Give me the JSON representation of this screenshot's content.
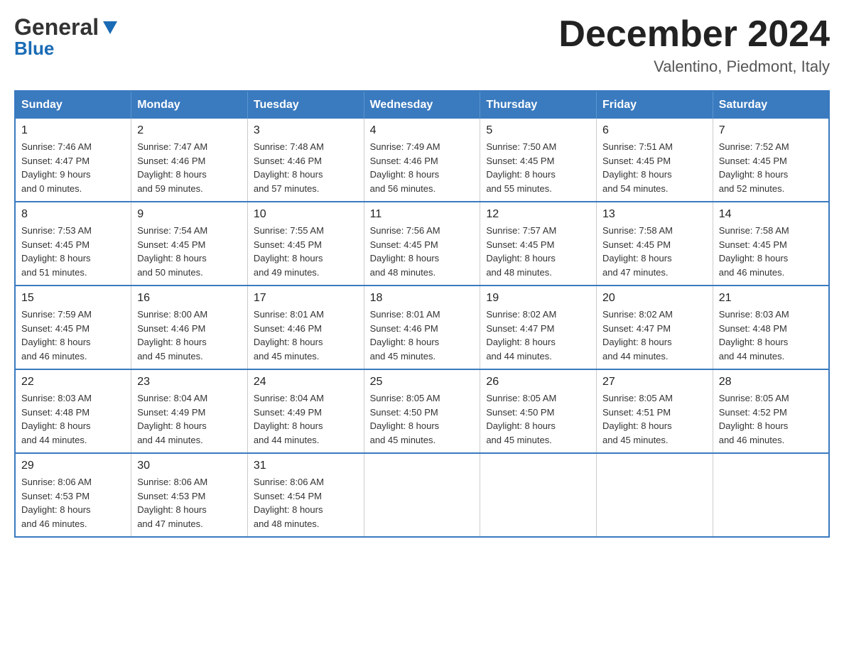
{
  "header": {
    "logo": {
      "line1": "General",
      "line2": "Blue"
    },
    "title": "December 2024",
    "location": "Valentino, Piedmont, Italy"
  },
  "days_of_week": [
    "Sunday",
    "Monday",
    "Tuesday",
    "Wednesday",
    "Thursday",
    "Friday",
    "Saturday"
  ],
  "weeks": [
    [
      {
        "day": 1,
        "sunrise": "7:46 AM",
        "sunset": "4:47 PM",
        "daylight_hours": 9,
        "daylight_minutes": 0
      },
      {
        "day": 2,
        "sunrise": "7:47 AM",
        "sunset": "4:46 PM",
        "daylight_hours": 8,
        "daylight_minutes": 59
      },
      {
        "day": 3,
        "sunrise": "7:48 AM",
        "sunset": "4:46 PM",
        "daylight_hours": 8,
        "daylight_minutes": 57
      },
      {
        "day": 4,
        "sunrise": "7:49 AM",
        "sunset": "4:46 PM",
        "daylight_hours": 8,
        "daylight_minutes": 56
      },
      {
        "day": 5,
        "sunrise": "7:50 AM",
        "sunset": "4:45 PM",
        "daylight_hours": 8,
        "daylight_minutes": 55
      },
      {
        "day": 6,
        "sunrise": "7:51 AM",
        "sunset": "4:45 PM",
        "daylight_hours": 8,
        "daylight_minutes": 54
      },
      {
        "day": 7,
        "sunrise": "7:52 AM",
        "sunset": "4:45 PM",
        "daylight_hours": 8,
        "daylight_minutes": 52
      }
    ],
    [
      {
        "day": 8,
        "sunrise": "7:53 AM",
        "sunset": "4:45 PM",
        "daylight_hours": 8,
        "daylight_minutes": 51
      },
      {
        "day": 9,
        "sunrise": "7:54 AM",
        "sunset": "4:45 PM",
        "daylight_hours": 8,
        "daylight_minutes": 50
      },
      {
        "day": 10,
        "sunrise": "7:55 AM",
        "sunset": "4:45 PM",
        "daylight_hours": 8,
        "daylight_minutes": 49
      },
      {
        "day": 11,
        "sunrise": "7:56 AM",
        "sunset": "4:45 PM",
        "daylight_hours": 8,
        "daylight_minutes": 48
      },
      {
        "day": 12,
        "sunrise": "7:57 AM",
        "sunset": "4:45 PM",
        "daylight_hours": 8,
        "daylight_minutes": 48
      },
      {
        "day": 13,
        "sunrise": "7:58 AM",
        "sunset": "4:45 PM",
        "daylight_hours": 8,
        "daylight_minutes": 47
      },
      {
        "day": 14,
        "sunrise": "7:58 AM",
        "sunset": "4:45 PM",
        "daylight_hours": 8,
        "daylight_minutes": 46
      }
    ],
    [
      {
        "day": 15,
        "sunrise": "7:59 AM",
        "sunset": "4:45 PM",
        "daylight_hours": 8,
        "daylight_minutes": 46
      },
      {
        "day": 16,
        "sunrise": "8:00 AM",
        "sunset": "4:46 PM",
        "daylight_hours": 8,
        "daylight_minutes": 45
      },
      {
        "day": 17,
        "sunrise": "8:01 AM",
        "sunset": "4:46 PM",
        "daylight_hours": 8,
        "daylight_minutes": 45
      },
      {
        "day": 18,
        "sunrise": "8:01 AM",
        "sunset": "4:46 PM",
        "daylight_hours": 8,
        "daylight_minutes": 45
      },
      {
        "day": 19,
        "sunrise": "8:02 AM",
        "sunset": "4:47 PM",
        "daylight_hours": 8,
        "daylight_minutes": 44
      },
      {
        "day": 20,
        "sunrise": "8:02 AM",
        "sunset": "4:47 PM",
        "daylight_hours": 8,
        "daylight_minutes": 44
      },
      {
        "day": 21,
        "sunrise": "8:03 AM",
        "sunset": "4:48 PM",
        "daylight_hours": 8,
        "daylight_minutes": 44
      }
    ],
    [
      {
        "day": 22,
        "sunrise": "8:03 AM",
        "sunset": "4:48 PM",
        "daylight_hours": 8,
        "daylight_minutes": 44
      },
      {
        "day": 23,
        "sunrise": "8:04 AM",
        "sunset": "4:49 PM",
        "daylight_hours": 8,
        "daylight_minutes": 44
      },
      {
        "day": 24,
        "sunrise": "8:04 AM",
        "sunset": "4:49 PM",
        "daylight_hours": 8,
        "daylight_minutes": 44
      },
      {
        "day": 25,
        "sunrise": "8:05 AM",
        "sunset": "4:50 PM",
        "daylight_hours": 8,
        "daylight_minutes": 45
      },
      {
        "day": 26,
        "sunrise": "8:05 AM",
        "sunset": "4:50 PM",
        "daylight_hours": 8,
        "daylight_minutes": 45
      },
      {
        "day": 27,
        "sunrise": "8:05 AM",
        "sunset": "4:51 PM",
        "daylight_hours": 8,
        "daylight_minutes": 45
      },
      {
        "day": 28,
        "sunrise": "8:05 AM",
        "sunset": "4:52 PM",
        "daylight_hours": 8,
        "daylight_minutes": 46
      }
    ],
    [
      {
        "day": 29,
        "sunrise": "8:06 AM",
        "sunset": "4:53 PM",
        "daylight_hours": 8,
        "daylight_minutes": 46
      },
      {
        "day": 30,
        "sunrise": "8:06 AM",
        "sunset": "4:53 PM",
        "daylight_hours": 8,
        "daylight_minutes": 47
      },
      {
        "day": 31,
        "sunrise": "8:06 AM",
        "sunset": "4:54 PM",
        "daylight_hours": 8,
        "daylight_minutes": 48
      },
      null,
      null,
      null,
      null
    ]
  ]
}
